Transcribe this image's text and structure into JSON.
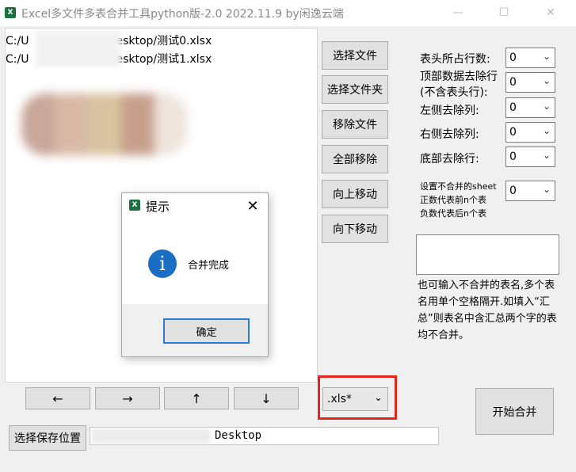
{
  "window": {
    "title": "Excel多文件多表合并工具python版-2.0 2022.11.9 by闲逸云端",
    "minimize": "—",
    "maximize": "☐",
    "close": "✕"
  },
  "file_list": {
    "items": [
      {
        "prefix": "C:/U",
        "suffix": "esktop/测试0.xlsx"
      },
      {
        "prefix": "C:/U",
        "suffix": "esktop/测试1.xlsx"
      }
    ]
  },
  "buttons": {
    "select_file": "选择文件",
    "select_folder": "选择文件夹",
    "remove_file": "移除文件",
    "remove_all": "全部移除",
    "move_up": "向上移动",
    "move_down": "向下移动",
    "start_merge": "开始合并",
    "save_location": "选择保存位置"
  },
  "arrows": {
    "left": "←",
    "right": "→",
    "up": "↑",
    "down": "↓"
  },
  "settings": {
    "header_rows": {
      "label": "表头所占行数:",
      "value": "0"
    },
    "top_remove": {
      "label_line1": "顶部数据去除行",
      "label_line2": "(不含表头行):",
      "value": "0"
    },
    "left_remove": {
      "label": "左侧去除列:",
      "value": "0"
    },
    "right_remove": {
      "label": "右侧去除列:",
      "value": "0"
    },
    "bottom_remove": {
      "label": "底部去除行:",
      "value": "0"
    },
    "sheet_skip": {
      "label_line1": "设置不合并的sheet",
      "label_line2": "正数代表前n个表",
      "label_line3": "负数代表后n个表",
      "value": "0"
    }
  },
  "exclude_note": "也可输入不合并的表名,多个表名用单个空格隔开.如填入“汇总”则表名中含汇总两个字的表均不合并。",
  "extension_filter": ".xls*",
  "save_path": "Desktop",
  "dialog": {
    "title": "提示",
    "close": "✕",
    "icon_glyph": "i",
    "message": "合并完成",
    "ok": "确定"
  },
  "icons": {
    "app": "excel-icon",
    "dialog_app": "excel-icon",
    "info": "info-icon"
  },
  "colors": {
    "highlight_border": "#e0281c",
    "info_icon": "#1a6fc4",
    "excel_green": "#1d6f42"
  }
}
